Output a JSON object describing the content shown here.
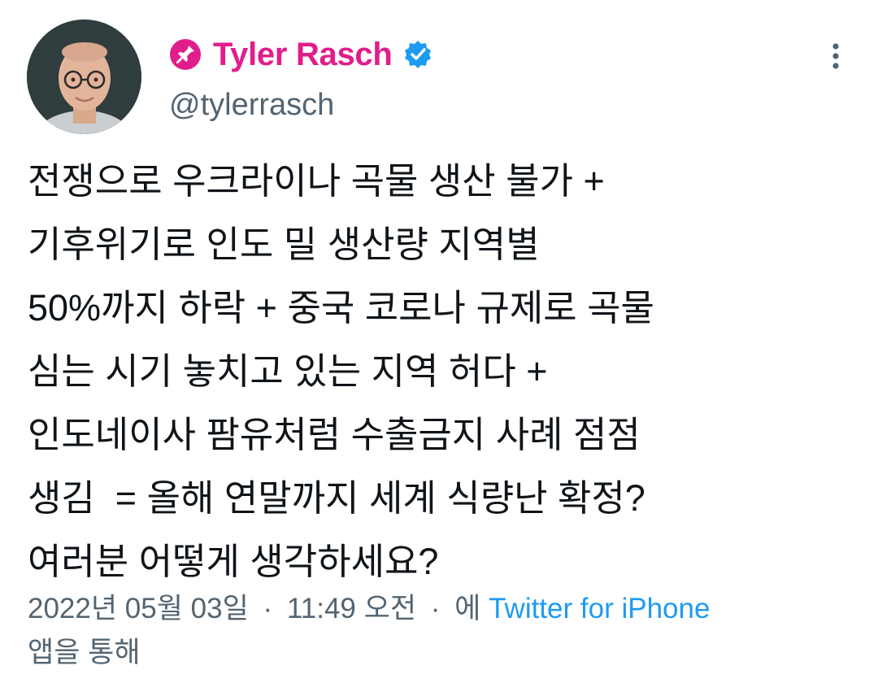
{
  "user": {
    "display_name": "Tyler Rasch",
    "handle": "@tylerrasch",
    "name_color": "#e11d8c",
    "verified": true
  },
  "icons": {
    "name_prefix": "pin-icon",
    "verified": "verified-badge-icon",
    "menu": "more-vertical-icon",
    "avatar": "avatar-photo"
  },
  "tweet": {
    "text": "전쟁으로 우크라이나 곡물 생산 불가 +\n기후위기로 인도 밀 생산량 지역별\n50%까지 하락 + 중국 코로나 규제로 곡물\n심는 시기 놓치고 있는 지역 허다 +\n인도네이사 팜유처럼 수출금지 사례 점점\n생김  = 올해 연말까지 세계 식량난 확정?\n여러분 어떻게 생각하세요?"
  },
  "meta": {
    "date": "2022년 05월 03일",
    "separator": "·",
    "time": "11:49 오전",
    "via_prefix": "에",
    "source": "Twitter for iPhone",
    "via_suffix": "앱을 통해"
  },
  "colors": {
    "link": "#1d9bf0",
    "secondary": "#536471",
    "text": "#0f1419"
  }
}
